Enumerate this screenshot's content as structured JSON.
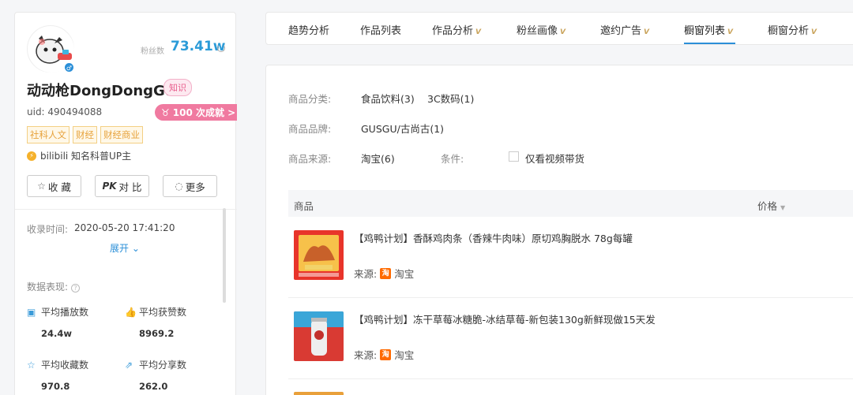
{
  "profile": {
    "fans_label": "粉丝数",
    "fans_value": "73.41w",
    "name": "动动枪DongDongGun",
    "zhishi_badge": "知识",
    "uid": "uid: 490494088",
    "deal_badge": "100 次成就 >",
    "tags": [
      "社科人文",
      "财经",
      "财经商业"
    ],
    "up_text": "bilibili 知名科普UP主",
    "buttons": {
      "collect": "收 藏",
      "compare_prefix": "PK",
      "compare": "对 比",
      "more": "更多"
    },
    "collect_time_label": "收录时间:",
    "collect_time_value": "2020-05-20 17:41:20",
    "expand": "展开",
    "perf_title": "数据表现:",
    "stats": [
      {
        "label": "平均播放数",
        "value": "24.4w"
      },
      {
        "label": "平均获赞数",
        "value": "8969.2"
      },
      {
        "label": "平均收藏数",
        "value": "970.8"
      },
      {
        "label": "平均分享数",
        "value": "262.0"
      }
    ]
  },
  "tabs": [
    {
      "label": "趋势分析",
      "vip": ""
    },
    {
      "label": "作品列表",
      "vip": ""
    },
    {
      "label": "作品分析",
      "vip": "VIP"
    },
    {
      "label": "粉丝画像",
      "vip": "VIP"
    },
    {
      "label": "邀约广告",
      "vip": "VIP"
    },
    {
      "label": "橱窗列表",
      "vip": "VIP"
    },
    {
      "label": "橱窗分析",
      "vip": "VIP"
    }
  ],
  "active_tab": "橱窗列表",
  "filters": {
    "category_label": "商品分类:",
    "categories": [
      "食品饮料(3)",
      "3C数码(1)"
    ],
    "brand_label": "商品品牌:",
    "brands": [
      "GUSGU/古尚古(1)"
    ],
    "source_label": "商品来源:",
    "sources": [
      "淘宝(6)"
    ],
    "condition_label": "条件:",
    "condition_option": "仅看视频带货"
  },
  "table": {
    "col_product": "商品",
    "col_price": "价格",
    "rows": [
      {
        "title": "【鸡鸭计划】香酥鸡肉条（香辣牛肉味）原切鸡胸脱水 78g每罐",
        "source_label": "来源:",
        "source_icon": "淘",
        "source": "淘宝"
      },
      {
        "title": "【鸡鸭计划】冻干草莓冰糖脆-冰结草莓-新包装130g新鲜现做15天发",
        "source_label": "来源:",
        "source_icon": "淘",
        "source": "淘宝"
      }
    ]
  },
  "colors": {
    "accent": "#2b8fd8",
    "pink": "#f07aa0",
    "tag": "#e7a23b",
    "taobao": "#ff6a00"
  }
}
